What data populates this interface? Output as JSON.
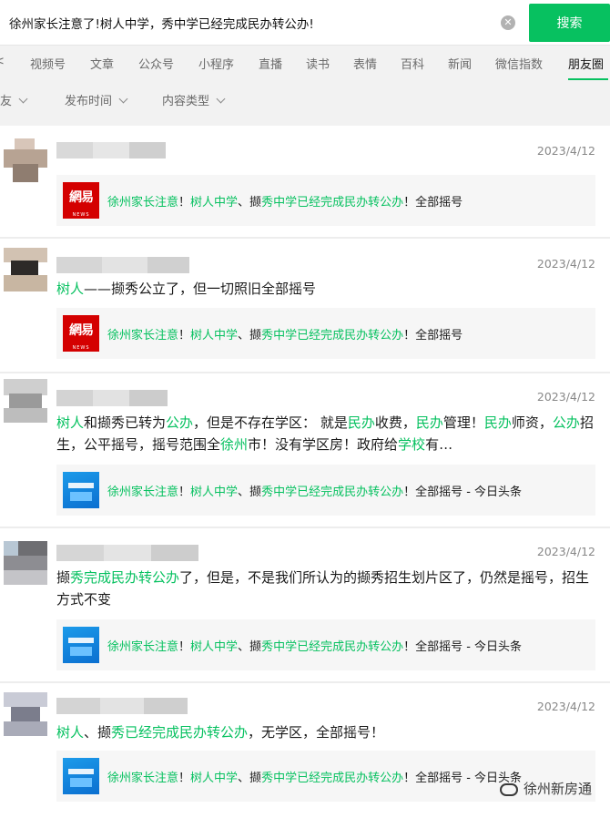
{
  "search": {
    "query": "徐州家长注意了!树人中学，秀中学已经完成民办转公办!",
    "clear_icon": "close-circle-icon",
    "button_label": "搜索"
  },
  "tabs": [
    "视频号",
    "文章",
    "公众号",
    "小程序",
    "直播",
    "读书",
    "表情",
    "百科",
    "新闻",
    "微信指数",
    "朋友圈"
  ],
  "active_tab": "朋友圈",
  "filters": [
    "朋友",
    "发布时间",
    "内容类型"
  ],
  "colors": {
    "accent": "#07c160",
    "card_bg": "#f6f6f6",
    "netease_red": "#d40000"
  },
  "posts": [
    {
      "date": "2023/4/12",
      "text_parts": [],
      "card": {
        "icon": "netease-news-icon",
        "title_parts": [
          {
            "t": "徐州家长注意",
            "hl": true
          },
          {
            "t": "！",
            "hl": false
          },
          {
            "t": "树人中学",
            "hl": true
          },
          {
            "t": "、撷",
            "hl": false
          },
          {
            "t": "秀中学已经完成民办转公办",
            "hl": true
          },
          {
            "t": "！全部摇号",
            "hl": false
          }
        ]
      }
    },
    {
      "date": "2023/4/12",
      "text_parts": [
        {
          "t": "树人",
          "hl": true
        },
        {
          "t": "——撷秀公立了，但一切照旧全部摇号",
          "hl": false
        }
      ],
      "card": {
        "icon": "netease-news-icon",
        "title_parts": [
          {
            "t": "徐州家长注意",
            "hl": true
          },
          {
            "t": "！",
            "hl": false
          },
          {
            "t": "树人中学",
            "hl": true
          },
          {
            "t": "、撷",
            "hl": false
          },
          {
            "t": "秀中学已经完成民办转公办",
            "hl": true
          },
          {
            "t": "！全部摇号",
            "hl": false
          }
        ]
      }
    },
    {
      "date": "2023/4/12",
      "text_parts": [
        {
          "t": "树人",
          "hl": true
        },
        {
          "t": "和撷秀已转为",
          "hl": false
        },
        {
          "t": "公办",
          "hl": true
        },
        {
          "t": "，但是不存在学区： 就是",
          "hl": false
        },
        {
          "t": "民办",
          "hl": true
        },
        {
          "t": "收费，",
          "hl": false
        },
        {
          "t": "民办",
          "hl": true
        },
        {
          "t": "管理！",
          "hl": false
        },
        {
          "t": "民办",
          "hl": true
        },
        {
          "t": "师资，",
          "hl": false
        },
        {
          "t": "公办",
          "hl": true
        },
        {
          "t": "招生，公平摇号，摇号范围全",
          "hl": false
        },
        {
          "t": "徐州",
          "hl": true
        },
        {
          "t": "市！没有学区房！政府给",
          "hl": false
        },
        {
          "t": "学校",
          "hl": true
        },
        {
          "t": "有…",
          "hl": false
        }
      ],
      "card": {
        "icon": "toutiao-thumb-icon",
        "title_parts": [
          {
            "t": "徐州家长注意",
            "hl": true
          },
          {
            "t": "！",
            "hl": false
          },
          {
            "t": "树人中学",
            "hl": true
          },
          {
            "t": "、撷",
            "hl": false
          },
          {
            "t": "秀中学已经完成民办转公办",
            "hl": true
          },
          {
            "t": "！全部摇号 - 今日头条",
            "hl": false
          }
        ]
      }
    },
    {
      "date": "2023/4/12",
      "text_parts": [
        {
          "t": "撷",
          "hl": false
        },
        {
          "t": "秀完成民办转公办",
          "hl": true
        },
        {
          "t": "了，但是，不是我们所认为的撷秀招生划片区了，仍然是摇号，招生方式不变",
          "hl": false
        }
      ],
      "card": {
        "icon": "toutiao-thumb-icon",
        "title_parts": [
          {
            "t": "徐州家长注意",
            "hl": true
          },
          {
            "t": "！",
            "hl": false
          },
          {
            "t": "树人中学",
            "hl": true
          },
          {
            "t": "、撷",
            "hl": false
          },
          {
            "t": "秀中学已经完成民办转公办",
            "hl": true
          },
          {
            "t": "！全部摇号 - 今日头条",
            "hl": false
          }
        ]
      }
    },
    {
      "date": "2023/4/12",
      "text_parts": [
        {
          "t": "树人",
          "hl": true
        },
        {
          "t": "、撷",
          "hl": false
        },
        {
          "t": "秀已经完成民办转公办",
          "hl": true
        },
        {
          "t": "，无学区，全部摇号！",
          "hl": false
        }
      ],
      "card": {
        "icon": "toutiao-thumb-icon",
        "title_parts": [
          {
            "t": "徐州家长注意",
            "hl": true
          },
          {
            "t": "！",
            "hl": false
          },
          {
            "t": "树人中学",
            "hl": true
          },
          {
            "t": "、撷",
            "hl": false
          },
          {
            "t": "秀中学已经完成民办转公办",
            "hl": true
          },
          {
            "t": "！全部摇号 - 今日头条",
            "hl": false
          }
        ]
      }
    }
  ],
  "watermark": {
    "icon": "wechat-official-account-icon",
    "text": "徐州新房通"
  }
}
